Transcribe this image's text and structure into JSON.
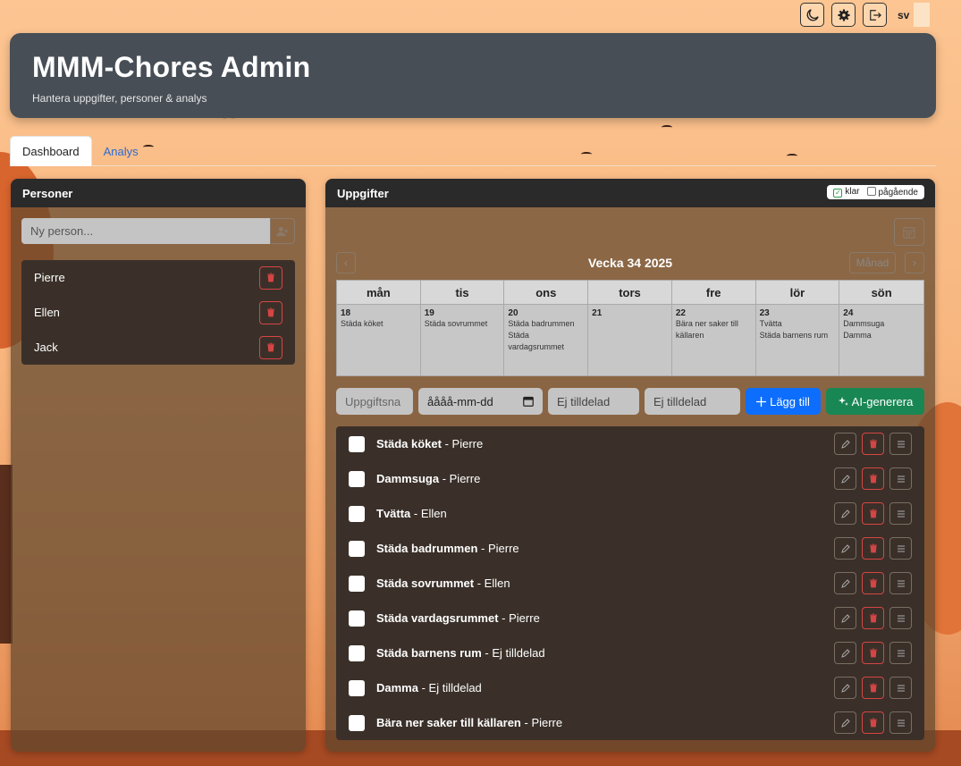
{
  "app": {
    "title": "MMM-Chores Admin",
    "subtitle": "Hantera uppgifter, personer & analys",
    "lang": "sv"
  },
  "topbar": {
    "icons": [
      "moon-icon",
      "gear-icon",
      "logout-icon"
    ]
  },
  "tabs": [
    {
      "label": "Dashboard",
      "active": true
    },
    {
      "label": "Analys",
      "active": false
    }
  ],
  "persons_panel": {
    "title": "Personer",
    "input_placeholder": "Ny person...",
    "people": [
      {
        "name": "Pierre"
      },
      {
        "name": "Ellen"
      },
      {
        "name": "Jack"
      }
    ]
  },
  "tasks_panel": {
    "title": "Uppgifter",
    "legend": {
      "done": "klar",
      "ongoing": "pågående"
    },
    "week_title": "Vecka 34 2025",
    "month_button": "Månad",
    "prev_icon": "‹",
    "next_icon": "›",
    "calendar": [
      {
        "day": "mån",
        "date": "18",
        "tasks": [
          "Städa köket"
        ]
      },
      {
        "day": "tis",
        "date": "19",
        "tasks": [
          "Städa sovrummet"
        ]
      },
      {
        "day": "ons",
        "date": "20",
        "tasks": [
          "Städa badrummen",
          "Städa vardagsrummet"
        ]
      },
      {
        "day": "tors",
        "date": "21",
        "tasks": []
      },
      {
        "day": "fre",
        "date": "22",
        "tasks": [
          "Bära ner saker till källaren"
        ]
      },
      {
        "day": "lör",
        "date": "23",
        "tasks": [
          "Tvätta",
          "Städa barnens rum"
        ]
      },
      {
        "day": "sön",
        "date": "24",
        "tasks": [
          "Dammsuga",
          "Damma"
        ]
      }
    ],
    "add_form": {
      "task_placeholder": "Uppgiftsna",
      "date_placeholder": "åååå-mm-dd",
      "assignee_1": "Ej tilldelad",
      "assignee_2": "Ej tilldelad",
      "add_button": "Lägg till",
      "ai_button": "AI-generera"
    },
    "tasks": [
      {
        "title": "Städa köket",
        "assignee": "Pierre"
      },
      {
        "title": "Dammsuga",
        "assignee": "Pierre"
      },
      {
        "title": "Tvätta",
        "assignee": "Ellen"
      },
      {
        "title": "Städa badrummen",
        "assignee": "Pierre"
      },
      {
        "title": "Städa sovrummet",
        "assignee": "Ellen"
      },
      {
        "title": "Städa vardagsrummet",
        "assignee": "Pierre"
      },
      {
        "title": "Städa barnens rum",
        "assignee": "Ej tilldelad"
      },
      {
        "title": "Damma",
        "assignee": "Ej tilldelad"
      },
      {
        "title": "Bära ner saker till källaren",
        "assignee": "Pierre"
      }
    ]
  },
  "colors": {
    "header_bg": "#474e56",
    "primary": "#0d6efd",
    "success": "#198754",
    "danger": "#d64545"
  }
}
